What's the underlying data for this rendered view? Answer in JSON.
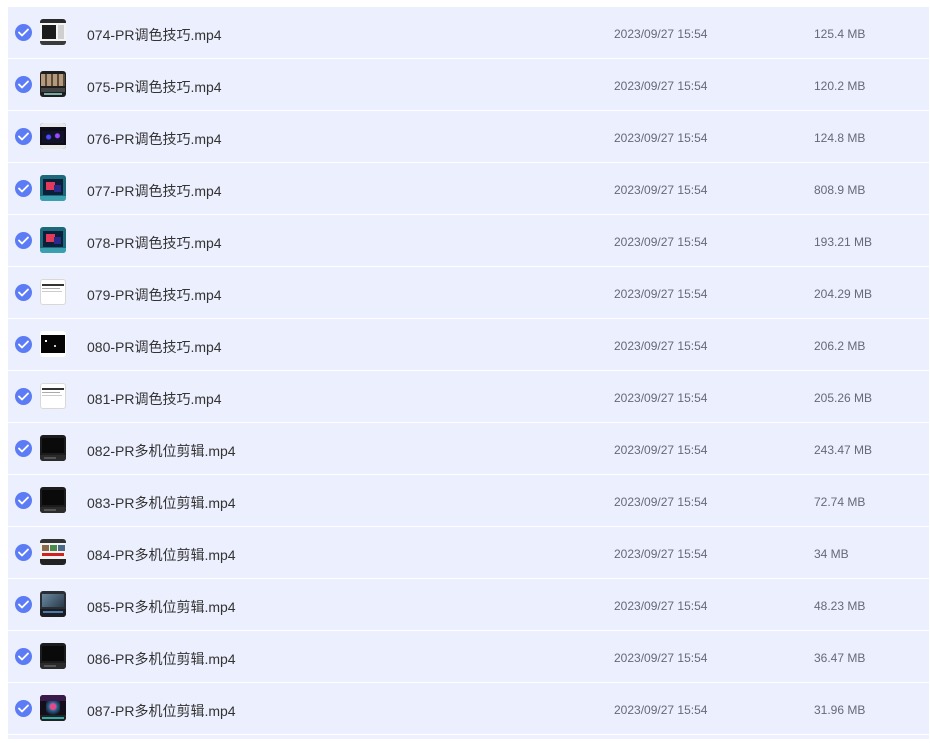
{
  "accent_color": "#5b7cf5",
  "row_background": "#eceffd",
  "files": [
    {
      "name": "074-PR调色技巧.mp4",
      "date": "2023/09/27 15:54",
      "size": "125.4 MB",
      "checked": true,
      "thumb": "editor-dark-icon"
    },
    {
      "name": "075-PR调色技巧.mp4",
      "date": "2023/09/27 15:54",
      "size": "120.2 MB",
      "checked": true,
      "thumb": "editor-grid-icon"
    },
    {
      "name": "076-PR调色技巧.mp4",
      "date": "2023/09/27 15:54",
      "size": "124.8 MB",
      "checked": true,
      "thumb": "editor-scope-icon"
    },
    {
      "name": "077-PR调色技巧.mp4",
      "date": "2023/09/27 15:54",
      "size": "808.9 MB",
      "checked": true,
      "thumb": "color-slide-icon"
    },
    {
      "name": "078-PR调色技巧.mp4",
      "date": "2023/09/27 15:54",
      "size": "193.21 MB",
      "checked": true,
      "thumb": "color-slide-icon"
    },
    {
      "name": "079-PR调色技巧.mp4",
      "date": "2023/09/27 15:54",
      "size": "204.29 MB",
      "checked": true,
      "thumb": "document-white-icon"
    },
    {
      "name": "080-PR调色技巧.mp4",
      "date": "2023/09/27 15:54",
      "size": "206.2 MB",
      "checked": true,
      "thumb": "black-frame-icon"
    },
    {
      "name": "081-PR调色技巧.mp4",
      "date": "2023/09/27 15:54",
      "size": "205.26 MB",
      "checked": true,
      "thumb": "document-white-icon"
    },
    {
      "name": "082-PR多机位剪辑.mp4",
      "date": "2023/09/27 15:54",
      "size": "243.47 MB",
      "checked": true,
      "thumb": "dark-video-icon"
    },
    {
      "name": "083-PR多机位剪辑.mp4",
      "date": "2023/09/27 15:54",
      "size": "72.74 MB",
      "checked": true,
      "thumb": "dark-video-icon"
    },
    {
      "name": "084-PR多机位剪辑.mp4",
      "date": "2023/09/27 15:54",
      "size": "34 MB",
      "checked": true,
      "thumb": "multi-grid-icon"
    },
    {
      "name": "085-PR多机位剪辑.mp4",
      "date": "2023/09/27 15:54",
      "size": "48.23 MB",
      "checked": true,
      "thumb": "editor-panel-icon"
    },
    {
      "name": "086-PR多机位剪辑.mp4",
      "date": "2023/09/27 15:54",
      "size": "36.47 MB",
      "checked": true,
      "thumb": "dark-video-icon"
    },
    {
      "name": "087-PR多机位剪辑.mp4",
      "date": "2023/09/27 15:54",
      "size": "31.96 MB",
      "checked": true,
      "thumb": "stage-video-icon"
    }
  ]
}
